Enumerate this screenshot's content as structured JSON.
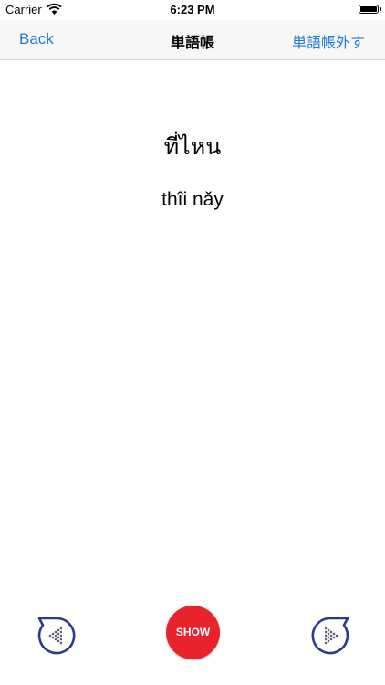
{
  "status_bar": {
    "carrier": "Carrier",
    "time": "6:23 PM",
    "wifi_icon": "wifi-icon",
    "battery_icon": "battery-icon"
  },
  "nav": {
    "back_label": "Back",
    "title": "単語帳",
    "right_label": "単語帳外す"
  },
  "card": {
    "word": "ที่ไหน",
    "romanization": "thîi nǎy"
  },
  "controls": {
    "prev_icon": "previous-arrow-icon",
    "show_label": "SHOW",
    "next_icon": "next-arrow-icon",
    "show_color": "#e8232d",
    "arrow_color": "#2b3a8f"
  },
  "colors": {
    "accent": "#1e7ad4",
    "nav_background": "#f7f7f8"
  }
}
